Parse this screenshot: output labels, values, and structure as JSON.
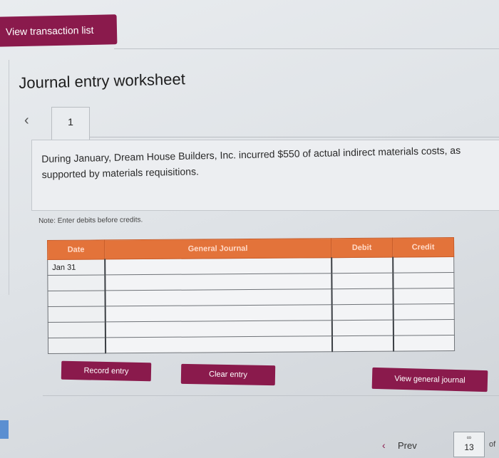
{
  "top_button": {
    "label": "View transaction list"
  },
  "page_title": "Journal entry worksheet",
  "tab": {
    "number": "1",
    "prev_icon": "chevron-left-icon"
  },
  "description": "During January, Dream House Builders, Inc. incurred $550 of actual indirect materials costs, as supported by materials requisitions.",
  "note": "Note: Enter debits before credits.",
  "table": {
    "headers": [
      "Date",
      "General Journal",
      "Debit",
      "Credit"
    ],
    "rows": [
      {
        "date": "Jan 31"
      },
      {
        "date": ""
      },
      {
        "date": ""
      },
      {
        "date": ""
      },
      {
        "date": ""
      },
      {
        "date": ""
      }
    ]
  },
  "buttons": {
    "record": "Record entry",
    "clear": "Clear entry",
    "view_journal": "View general journal"
  },
  "pagination": {
    "prev": "Prev",
    "page": "13",
    "of": "of"
  },
  "colors": {
    "brand": "#8a1a4c",
    "header": "#e3733a"
  }
}
